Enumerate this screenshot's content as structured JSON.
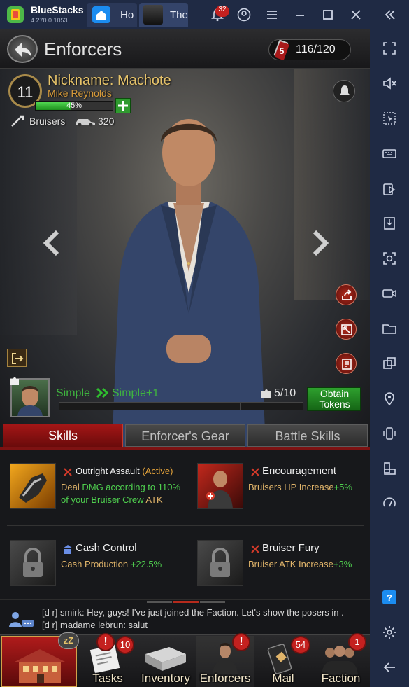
{
  "bluestacks": {
    "app_name": "BlueStacks",
    "version": "4.270.0.1053",
    "tabs": [
      {
        "label": "Ho"
      },
      {
        "label": "The"
      }
    ],
    "notification_count": "32"
  },
  "header": {
    "title": "Enforcers",
    "tokens": "116/120"
  },
  "enforcer": {
    "level": "11",
    "nickname": "Nickname: Machote",
    "name": "Mike Reynolds",
    "progress_label": "45%",
    "progress": 0.45,
    "crew_type": "Bruisers",
    "crew_power": "320",
    "grade_from": "Simple",
    "grade_to": "Simple+1",
    "shards": "5/10",
    "obtain_button": "Obtain\nTokens"
  },
  "tabs": [
    "Skills",
    "Enforcer's Gear",
    "Battle Skills"
  ],
  "skills": [
    {
      "name": "Outright Assault",
      "tag": "(Active)",
      "desc_prefix": "Deal ",
      "desc_green": "DMG according to 110% of your Bruiser Crew",
      "desc_suffix": "ATK",
      "locked": false
    },
    {
      "name": "Encouragement",
      "desc_prefix": "Bruisers HP Increase",
      "desc_green": "+5%",
      "locked": false
    },
    {
      "name": "Cash Control",
      "desc_prefix": "Cash Production ",
      "desc_green": "+22.5%",
      "locked": true
    },
    {
      "name": "Bruiser Fury",
      "desc_prefix": "Bruiser ATK Increase",
      "desc_green": "+3%",
      "locked": true
    }
  ],
  "chat": [
    "[d r] smirk: Hey, guys! I've just joined the Faction. Let's show the posers in .",
    "[d r] madame lebrun: salut"
  ],
  "nav": [
    {
      "label": "",
      "badge": ""
    },
    {
      "label": "Tasks",
      "badge": "10"
    },
    {
      "label": "Inventory",
      "badge": ""
    },
    {
      "label": "Enforcers",
      "badge": "!"
    },
    {
      "label": "Mail",
      "badge": "54"
    },
    {
      "label": "Faction",
      "badge": "1"
    }
  ],
  "colors": {
    "accent_red": "#8e1414",
    "progress_green": "#2fbf2f",
    "gold": "#e6c36a",
    "bluestacks_bar": "#1f2a44"
  }
}
